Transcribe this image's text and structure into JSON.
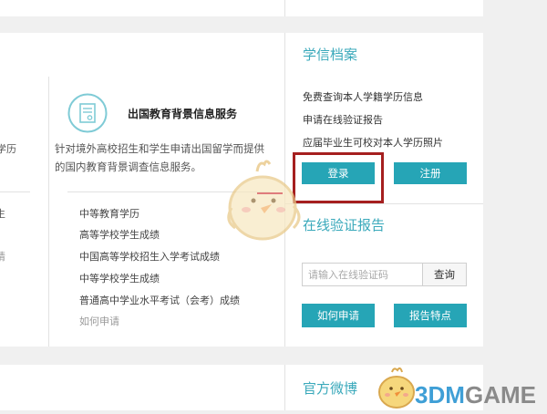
{
  "service": {
    "title": "出国教育背景信息服务",
    "description": "针对境外高校招生和学生申请出国留学而提供的国内教育背景调查信息服务。",
    "items": [
      "中等教育学历",
      "高等学校学生成绩",
      "中国高等学校招生入学考试成绩",
      "中等学校学生成绩",
      "普通高中学业水平考试（会考）成绩"
    ],
    "more_link": "如何申请"
  },
  "left_fragments": [
    "学历",
    "生",
    "请"
  ],
  "xuexin": {
    "heading": "学信档案",
    "links": [
      "免费查询本人学籍学历信息",
      "申请在线验证报告",
      "应届毕业生可校对本人学历照片"
    ],
    "login_label": "登录",
    "register_label": "注册"
  },
  "verify": {
    "heading": "在线验证报告",
    "placeholder": "请输入在线验证码",
    "query_label": "查询",
    "how_label": "如何申请",
    "features_label": "报告特点"
  },
  "weibo": {
    "heading": "官方微博"
  },
  "watermark": {
    "text_3dm": "3DM",
    "text_game": "GAME"
  },
  "colors": {
    "accent": "#26a5b6",
    "heading": "#3aa9bb",
    "highlight": "#a51f1f"
  }
}
